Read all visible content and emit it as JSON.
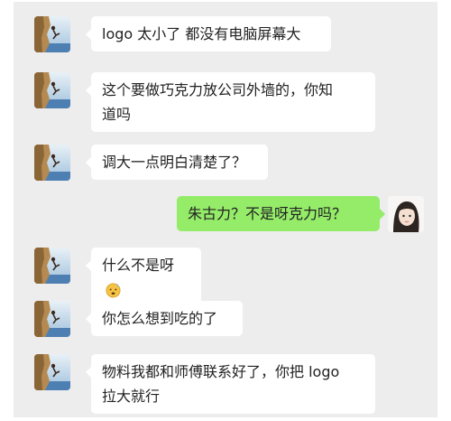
{
  "messages": [
    {
      "side": "left",
      "text": "logo 太小了 都没有电脑屏幕大"
    },
    {
      "side": "left",
      "lines": [
        "这个要做巧克力放公司外墙的，你知",
        "道吗"
      ]
    },
    {
      "side": "left",
      "text": "调大一点明白清楚了？"
    },
    {
      "side": "right",
      "text": "朱古力？不是呀克力吗？"
    },
    {
      "side": "left",
      "text": "什么不是呀",
      "emoji": "sweating-face-emoji"
    },
    {
      "side": "left",
      "text": "你怎么想到吃的了"
    },
    {
      "side": "left",
      "lines": [
        "物料我都和师傅联系好了，你把 logo",
        "拉大就行"
      ]
    }
  ],
  "colors": {
    "background": "#ededed",
    "incoming_bubble": "#ffffff",
    "outgoing_bubble": "#95ec69"
  }
}
